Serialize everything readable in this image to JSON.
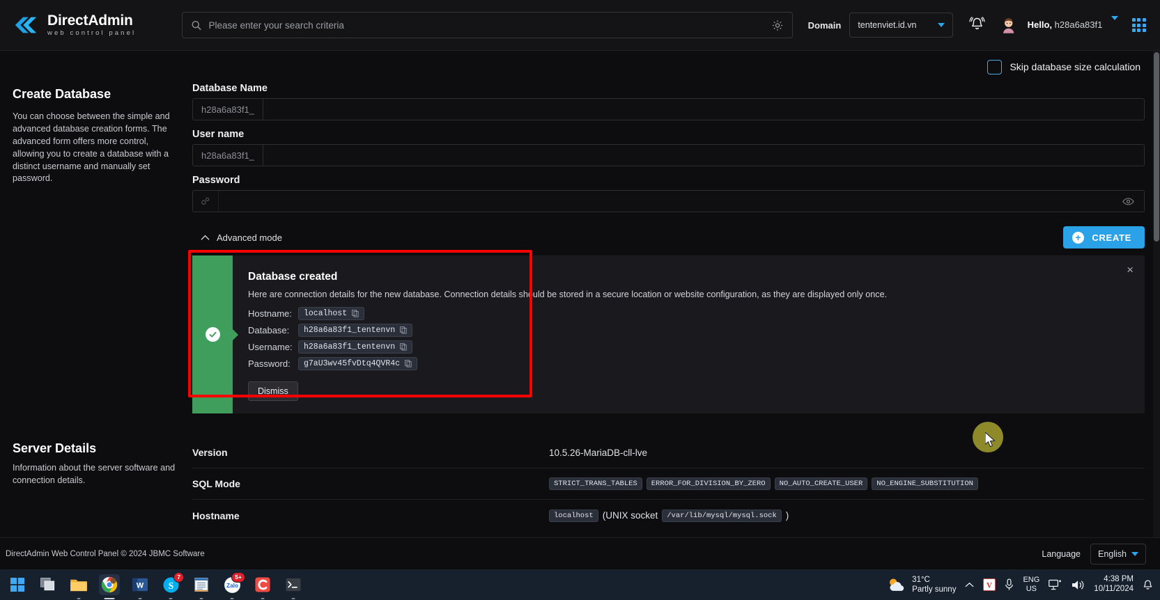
{
  "header": {
    "brand_title_1": "Direct",
    "brand_title_2": "Admin",
    "brand_sub": "web control panel",
    "search_placeholder": "Please enter your search criteria",
    "search_value": "",
    "domain_label": "Domain",
    "domain_value": "tentenviet.id.vn",
    "greeting_prefix": "Hello,",
    "greeting_user": "h28a6a83f1",
    "icons": {
      "search": "search-icon",
      "gear": "gear-icon",
      "bell": "notification-bell-icon",
      "avatar": "user-avatar-icon",
      "grid": "app-grid-icon",
      "caret": "chevron-down-icon"
    }
  },
  "toolbar": {
    "skip_calc_label": "Skip database size calculation",
    "skip_calc_checked": false
  },
  "sidebar": {
    "create_title": "Create Database",
    "create_desc": "You can choose between the simple and advanced database creation forms. The advanced form offers more control, allowing you to create a database with a distinct username and manually set password.",
    "server_title": "Server Details",
    "server_desc": "Information about the server software and connection details."
  },
  "form": {
    "db_name_label": "Database Name",
    "db_name_prefix": "h28a6a83f1_",
    "db_name_value": "",
    "user_name_label": "User name",
    "user_name_prefix": "h28a6a83f1_",
    "user_name_value": "",
    "password_label": "Password",
    "password_value": "",
    "advanced_mode_label": "Advanced mode",
    "create_label": "CREATE",
    "create_plus": "+"
  },
  "alert": {
    "title": "Database created",
    "description": "Here are connection details for the new database. Connection details should be stored in a secure location or website configuration, as they are displayed only once.",
    "credentials": [
      {
        "key": "Hostname:",
        "value": "localhost"
      },
      {
        "key": "Database:",
        "value": "h28a6a83f1_tentenvn"
      },
      {
        "key": "Username:",
        "value": "h28a6a83f1_tentenvn"
      },
      {
        "key": "Password:",
        "value": "g7aU3wv45fvDtq4QVR4c"
      }
    ],
    "dismiss_label": "Dismiss",
    "close_glyph": "×",
    "highlight_color": "#fe0000",
    "success_color": "#3f9e5c"
  },
  "server_details": {
    "version_label": "Version",
    "version_value": "10.5.26-MariaDB-cll-lve",
    "sql_mode_label": "SQL Mode",
    "sql_mode_chips": [
      "STRICT_TRANS_TABLES",
      "ERROR_FOR_DIVISION_BY_ZERO",
      "NO_AUTO_CREATE_USER",
      "NO_ENGINE_SUBSTITUTION"
    ],
    "hostname_label": "Hostname",
    "hostname_value": "localhost",
    "hostname_note_open": "(UNIX socket",
    "hostname_socket": "/var/lib/mysql/mysql.sock",
    "hostname_note_close": ")"
  },
  "footer": {
    "copyright": "DirectAdmin Web Control Panel © 2024 JBMC Software",
    "language_label": "Language",
    "language_value": "English"
  },
  "taskbar": {
    "weather_temp": "31°C",
    "weather_desc": "Partly sunny",
    "lang_line1": "ENG",
    "lang_line2": "US",
    "time": "4:38 PM",
    "date": "10/11/2024",
    "badges": {
      "skype": "7",
      "zalo": "5+"
    }
  }
}
